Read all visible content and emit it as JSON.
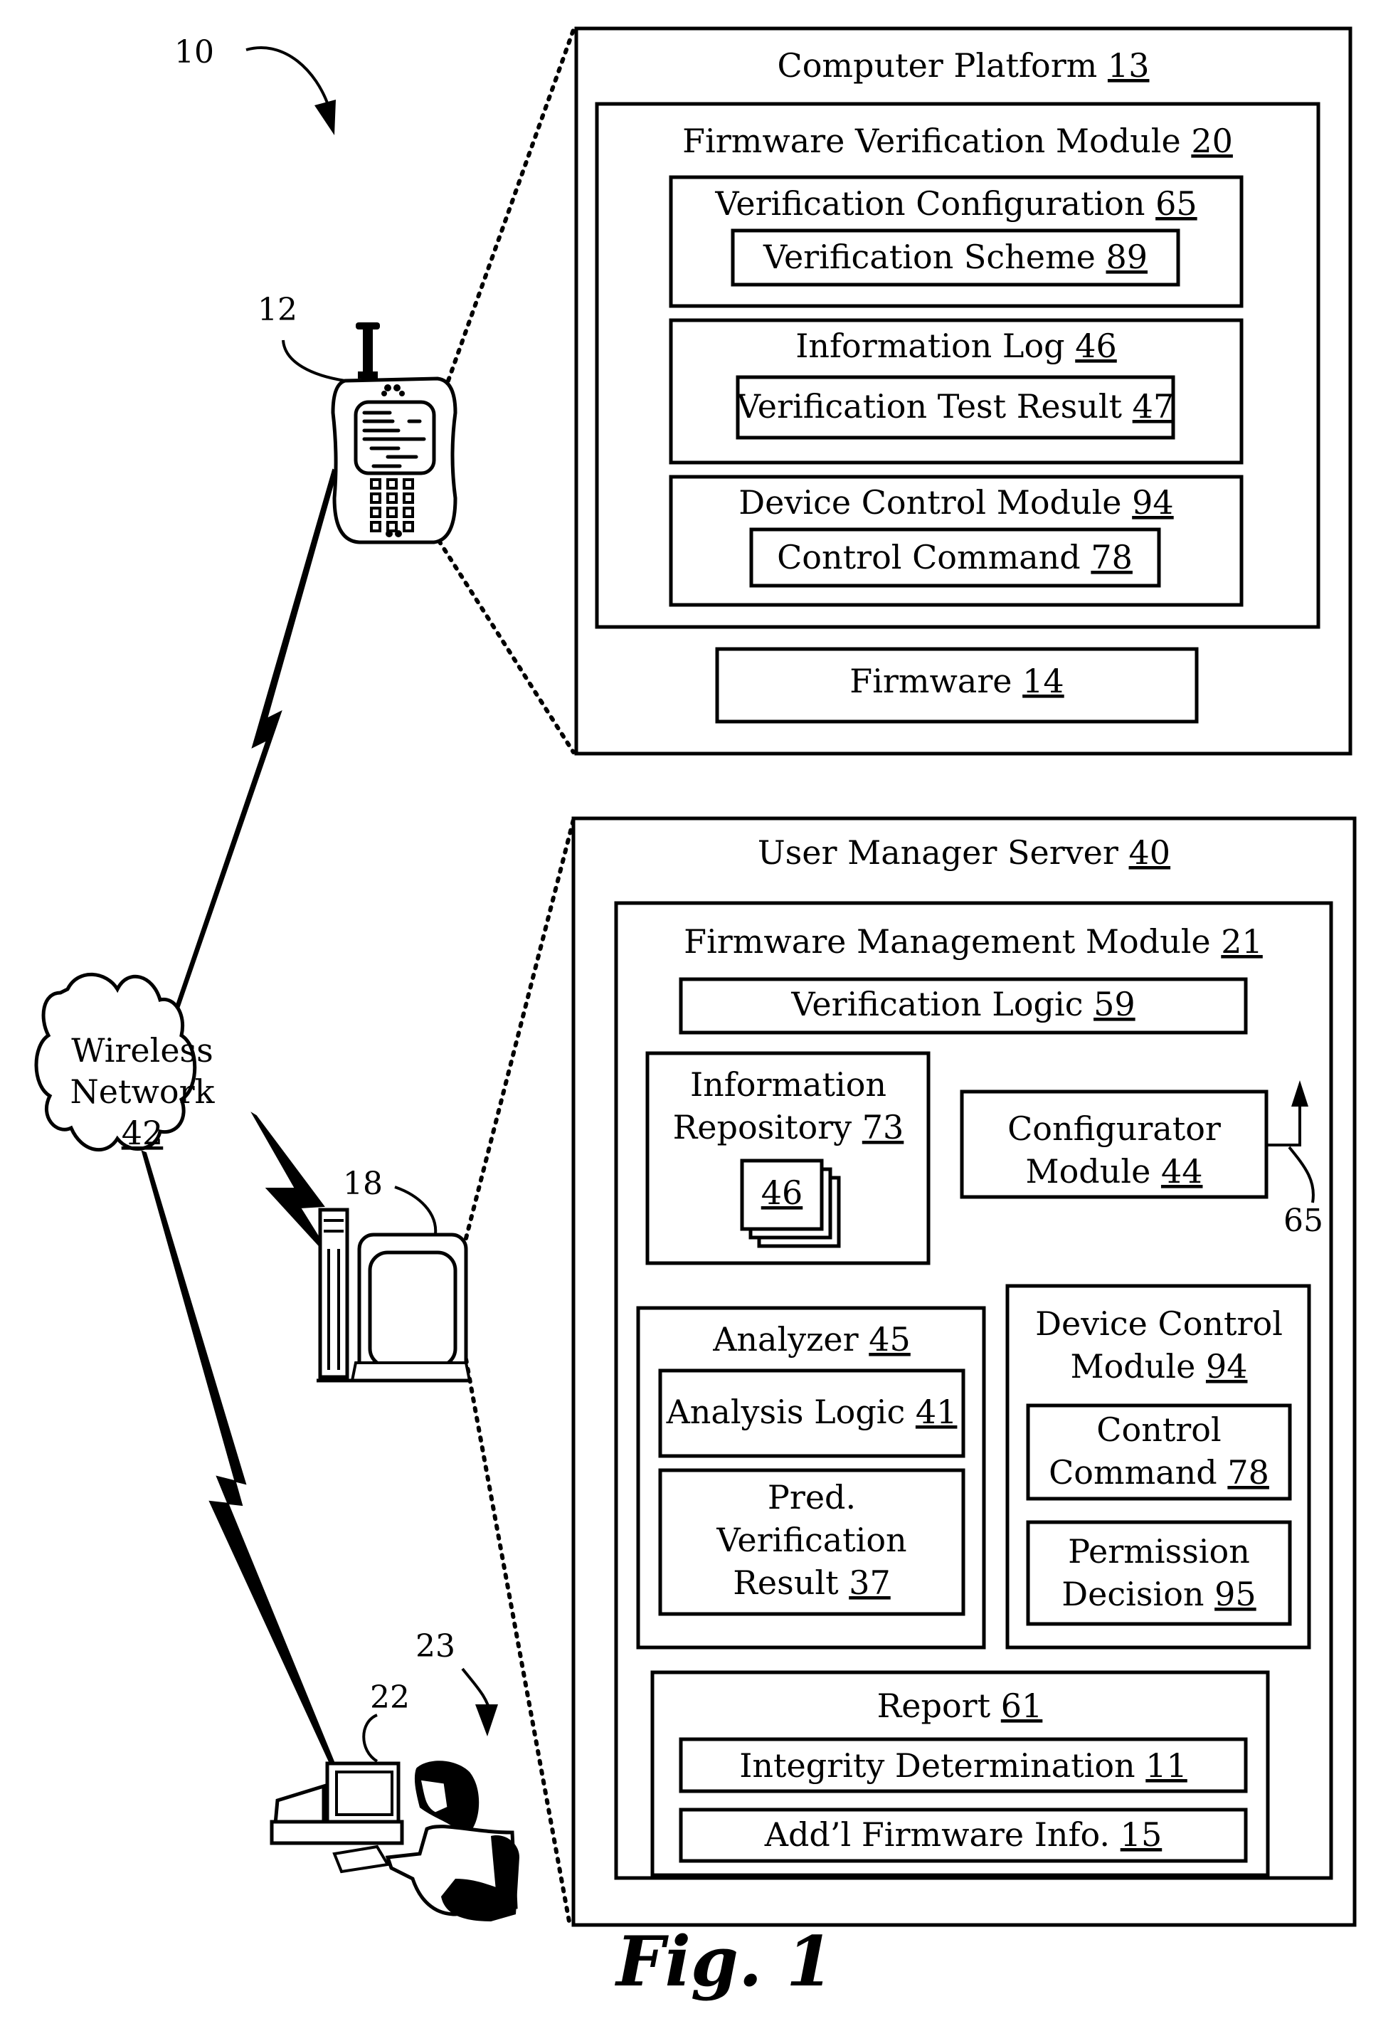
{
  "figure_label": "Fig. 1",
  "reference_numerals": {
    "system": "10",
    "wireless_device": "12",
    "server_computer": "18",
    "operator_computer": "22",
    "operator": "23",
    "configurator_output": "65"
  },
  "wireless_network": {
    "line1": "Wireless",
    "line2": "Network",
    "num": "42"
  },
  "computer_platform": {
    "title": "Computer Platform",
    "num": "13",
    "firmware_verification_module": {
      "title": "Firmware Verification Module",
      "num": "20",
      "verification_configuration": {
        "title": "Verification Configuration",
        "num": "65",
        "verification_scheme": {
          "title": "Verification Scheme",
          "num": "89"
        }
      },
      "information_log": {
        "title": "Information Log",
        "num": "46",
        "verification_test_result": {
          "title": "Verification Test Result",
          "num": "47"
        }
      },
      "device_control_module": {
        "title": "Device Control Module",
        "num": "94",
        "control_command": {
          "title": "Control Command",
          "num": "78"
        }
      }
    },
    "firmware": {
      "title": "Firmware",
      "num": "14"
    }
  },
  "user_manager_server": {
    "title": "User Manager Server",
    "num": "40",
    "firmware_management_module": {
      "title": "Firmware Management Module",
      "num": "21",
      "verification_logic": {
        "title": "Verification Logic",
        "num": "59"
      },
      "information_repository": {
        "line1": "Information",
        "line2": "Repository",
        "num": "73",
        "log_num": "46"
      },
      "configurator_module": {
        "line1": "Configurator",
        "line2": "Module",
        "num": "44"
      },
      "analyzer": {
        "title": "Analyzer",
        "num": "45",
        "analysis_logic": {
          "title": "Analysis Logic",
          "num": "41"
        },
        "pred_verification_result": {
          "line1": "Pred.",
          "line2": "Verification",
          "line3": "Result",
          "num": "37"
        }
      },
      "device_control_module": {
        "line1": "Device Control",
        "line2": "Module",
        "num": "94",
        "control_command": {
          "line1": "Control",
          "line2": "Command",
          "num": "78"
        },
        "permission_decision": {
          "line1": "Permission",
          "line2": "Decision",
          "num": "95"
        }
      },
      "report": {
        "title": "Report",
        "num": "61",
        "integrity_determination": {
          "title": "Integrity Determination",
          "num": "11"
        },
        "addl_firmware_info": {
          "title": "Add’l Firmware Info.",
          "num": "15"
        }
      }
    }
  }
}
